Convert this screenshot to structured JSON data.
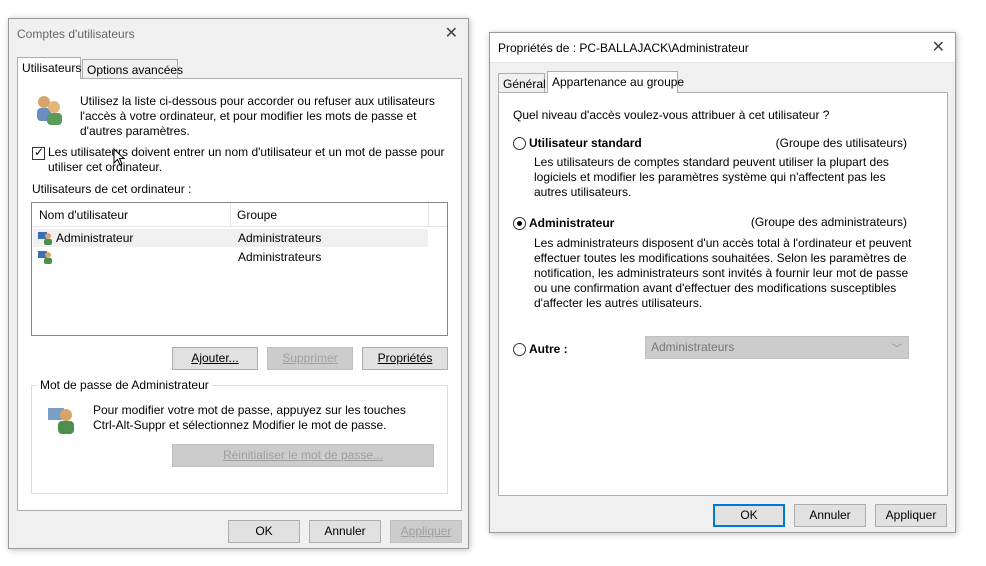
{
  "left": {
    "title": "Comptes d'utilisateurs",
    "tabs": [
      {
        "label": "Utilisateurs",
        "active": true
      },
      {
        "label": "Options avancées",
        "active": false
      }
    ],
    "intro_lines": [
      "Utilisez la liste ci-dessous pour accorder ou refuser aux utilisateurs",
      "l'accès à votre ordinateur, et pour modifier les mots de passe et",
      "d'autres paramètres."
    ],
    "require_login_lines": [
      "Les utilisateurs doivent entrer un nom d'utilisateur et un mot de passe pour",
      "utiliser cet ordinateur."
    ],
    "require_login_checked": true,
    "users_label": "Utilisateurs de cet ordinateur :",
    "columns": [
      "Nom d'utilisateur",
      "Groupe"
    ],
    "rows": [
      {
        "name": "Administrateur",
        "group": "Administrateurs"
      },
      {
        "name": "",
        "group": "Administrateurs"
      }
    ],
    "buttons": {
      "add": "Ajouter...",
      "remove": "Supprimer",
      "properties": "Propriétés"
    },
    "password_group": {
      "legend": "Mot de passe de Administrateur",
      "lines": [
        "Pour modifier votre mot de passe, appuyez sur les touches",
        "Ctrl-Alt-Suppr et sélectionnez Modifier le mot de passe."
      ],
      "reset_button": "Réinitialiser le mot de passe..."
    },
    "footer": {
      "ok": "OK",
      "cancel": "Annuler",
      "apply": "Appliquer"
    },
    "close_icon": "close-icon"
  },
  "right": {
    "title": "Propriétés de : PC-BALLAJACK\\Administrateur",
    "tabs": [
      {
        "label": "Général",
        "active": false
      },
      {
        "label": "Appartenance au groupe",
        "active": true
      }
    ],
    "question": "Quel niveau d'accès voulez-vous attribuer à cet utilisateur ?",
    "options": [
      {
        "label": "Utilisateur standard",
        "group": "(Groupe des utilisateurs)",
        "selected": false,
        "description": [
          "Les utilisateurs de comptes standard peuvent utiliser la plupart des",
          "logiciels et modifier les paramètres système qui n'affectent pas les",
          "autres utilisateurs."
        ]
      },
      {
        "label": "Administrateur",
        "group": "(Groupe des administrateurs)",
        "selected": true,
        "description": [
          "Les administrateurs disposent d'un accès total à l'ordinateur et peuvent",
          "effectuer toutes les modifications souhaitées. Selon les paramètres de",
          "notification, les administrateurs sont invités à fournir leur mot de passe",
          "ou une confirmation avant d'effectuer des modifications susceptibles",
          "d'affecter les autres utilisateurs."
        ]
      }
    ],
    "other": {
      "label": "Autre :",
      "selected": false,
      "dropdown_value": "Administrateurs"
    },
    "footer": {
      "ok": "OK",
      "cancel": "Annuler",
      "apply": "Appliquer"
    },
    "colors": {
      "default_button_border": "#0078d7"
    }
  }
}
